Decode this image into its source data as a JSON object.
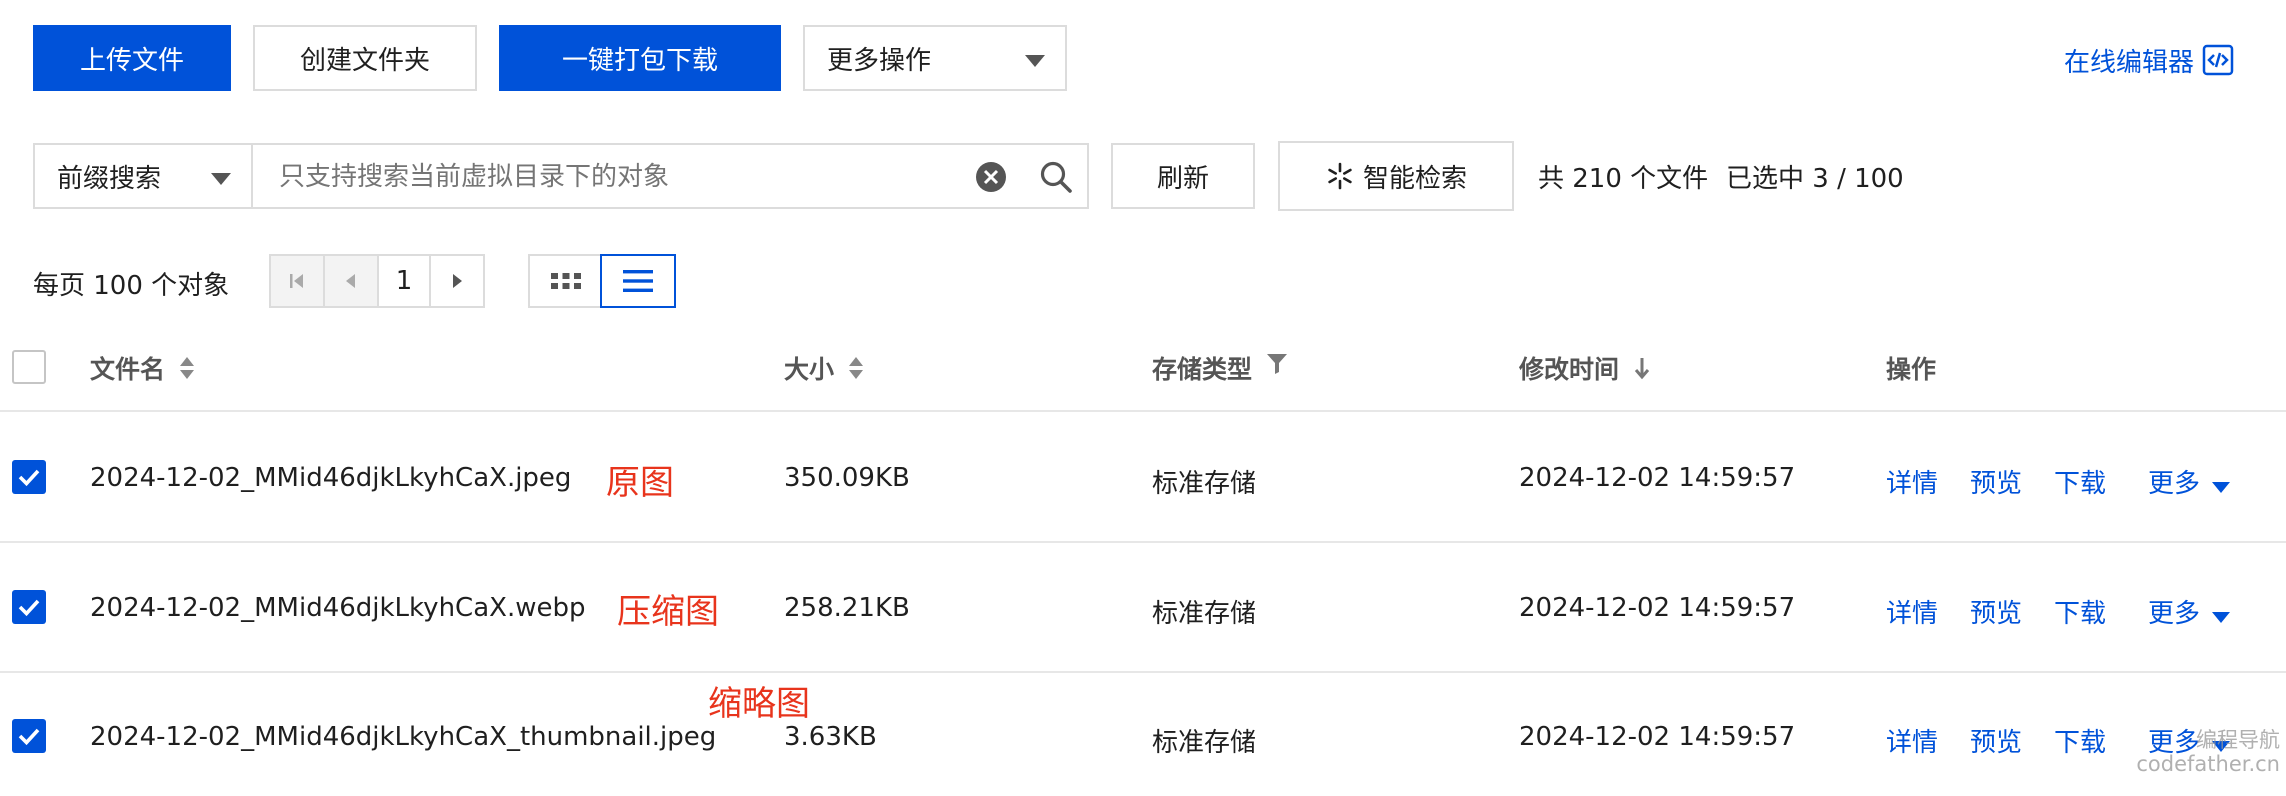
{
  "toolbar": {
    "upload_label": "上传文件",
    "create_folder_label": "创建文件夹",
    "pack_download_label": "一键打包下载",
    "more_actions_label": "更多操作",
    "online_editor_label": "在线编辑器"
  },
  "search": {
    "mode_label": "前缀搜索",
    "placeholder": "只支持搜索当前虚拟目录下的对象",
    "refresh_label": "刷新",
    "smart_search_label": "智能检索",
    "total_text": "共 210 个文件",
    "selected_text": "已选中 3 / 100"
  },
  "pagination": {
    "per_page_text": "每页 100 个对象",
    "current_page": "1"
  },
  "table": {
    "headers": {
      "name": "文件名",
      "size": "大小",
      "storage": "存储类型",
      "modified": "修改时间",
      "actions": "操作"
    },
    "rows": [
      {
        "name": "2024-12-02_MMid46djkLkyhCaX.jpeg",
        "size": "350.09KB",
        "storage": "标准存储",
        "modified": "2024-12-02 14:59:57",
        "annotation": "原图",
        "checked": true
      },
      {
        "name": "2024-12-02_MMid46djkLkyhCaX.webp",
        "size": "258.21KB",
        "storage": "标准存储",
        "modified": "2024-12-02 14:59:57",
        "annotation": "压缩图",
        "checked": true
      },
      {
        "name": "2024-12-02_MMid46djkLkyhCaX_thumbnail.jpeg",
        "size": "3.63KB",
        "storage": "标准存储",
        "modified": "2024-12-02 14:59:57",
        "annotation": "缩略图",
        "checked": true
      }
    ],
    "row_actions": {
      "details": "详情",
      "preview": "预览",
      "download": "下载",
      "more": "更多"
    }
  },
  "watermark": {
    "line1": "编程导航",
    "line2": "codefather.cn"
  },
  "colors": {
    "primary": "#0052d9",
    "annotation": "#e8341c",
    "border": "#dcdcdc"
  }
}
